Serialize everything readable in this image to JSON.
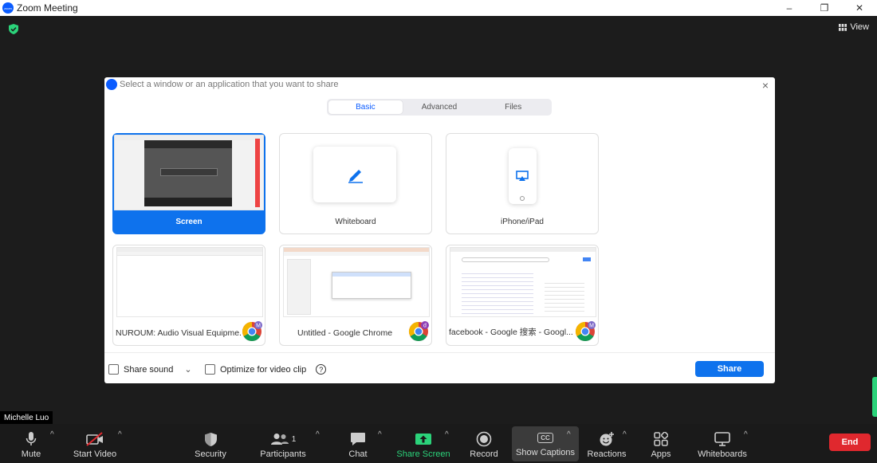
{
  "window": {
    "title": "Zoom Meeting",
    "logo_text": "zoom",
    "controls": [
      "–",
      "❐",
      "✕"
    ]
  },
  "view": {
    "label": "View"
  },
  "dialog": {
    "title": "Select a window or an application that you want to share",
    "close": "×",
    "tabs": [
      "Basic",
      "Advanced",
      "Files"
    ],
    "tiles": {
      "screen": "Screen",
      "whiteboard": "Whiteboard",
      "iphone": "iPhone/iPad",
      "app1": "NUROUM: Audio Visual Equipme...",
      "app2": "Untitled - Google Chrome",
      "app3": "facebook - Google 搜索 - Googl..."
    },
    "badges": {
      "app1": "M",
      "app2": "d",
      "app3": "M"
    },
    "share_sound": "Share sound",
    "share_sound_caret": "⌄",
    "optimize": "Optimize for video clip",
    "help": "?",
    "share_button": "Share"
  },
  "participant": {
    "name": "Michelle Luo"
  },
  "toolbar": {
    "mute": "Mute",
    "start_video": "Start Video",
    "security": "Security",
    "participants": "Participants",
    "participants_count": "1",
    "chat": "Chat",
    "share_screen": "Share Screen",
    "record": "Record",
    "show_captions": "Show Captions",
    "cc": "CC",
    "reactions": "Reactions",
    "apps": "Apps",
    "whiteboards": "Whiteboards",
    "end": "End",
    "caret": "^"
  },
  "colors": {
    "accent": "#0e72ed",
    "end": "#e0282e",
    "share_green": "#2bd37a"
  }
}
